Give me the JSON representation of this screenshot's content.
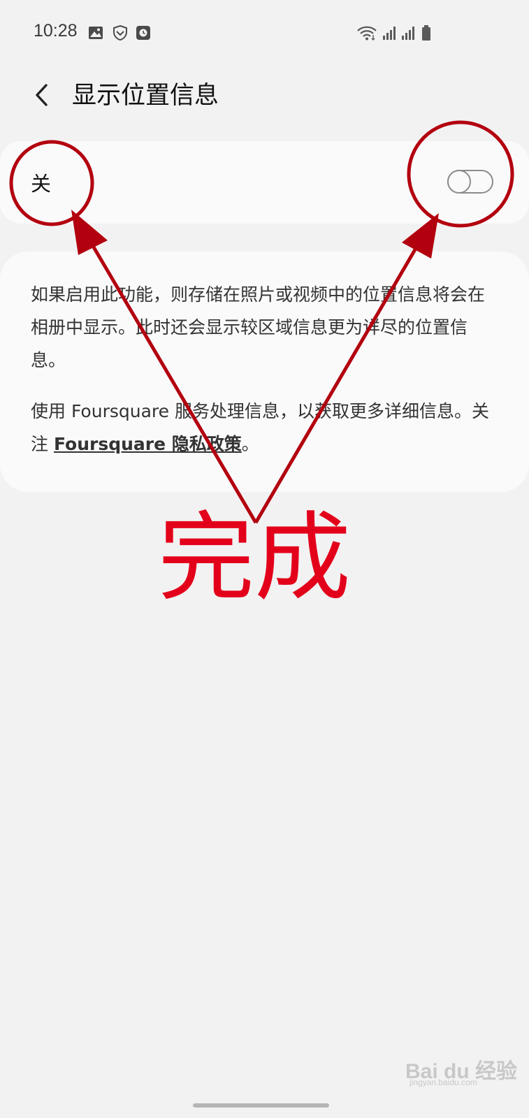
{
  "status_bar": {
    "time": "10:28",
    "left_icons": [
      "gallery-icon",
      "shield-icon",
      "clock-app-icon"
    ],
    "right_icons": [
      "wifi-icon",
      "signal-icon",
      "signal-icon",
      "battery-icon"
    ]
  },
  "header": {
    "back_icon": "chevron-left-icon",
    "title": "显示位置信息"
  },
  "toggle_row": {
    "label": "关",
    "state": "off"
  },
  "info": {
    "paragraph1": "如果启用此功能，则存储在照片或视频中的位置信息将会在相册中显示。此时还会显示较区域信息更为详尽的位置信息。",
    "paragraph2_prefix": "使用 Foursquare 服务处理信息，以获取更多详细信息。关注 ",
    "paragraph2_link": "Foursquare 隐私政策",
    "paragraph2_suffix": "。"
  },
  "annotation": {
    "text": "完成",
    "color": "#e3001a"
  },
  "watermark": {
    "text": "Bai du 经验",
    "subtext": "jingyan.baidu.com"
  }
}
